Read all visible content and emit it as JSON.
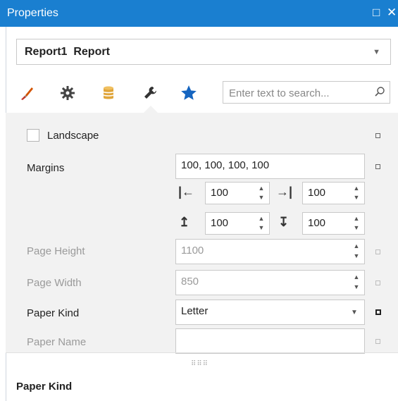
{
  "window": {
    "title": "Properties",
    "maximize_glyph": "□",
    "close_glyph": "✕"
  },
  "object_selector": {
    "name": "Report1",
    "type": "Report"
  },
  "tabs": [
    {
      "name": "appearance",
      "icon": "brush-icon"
    },
    {
      "name": "behavior",
      "icon": "gear-icon"
    },
    {
      "name": "data",
      "icon": "database-icon"
    },
    {
      "name": "layout",
      "icon": "wrench-icon",
      "selected": true
    },
    {
      "name": "favorites",
      "icon": "star-icon"
    }
  ],
  "search": {
    "placeholder": "Enter text to search..."
  },
  "properties": {
    "landscape": {
      "label": "Landscape",
      "checked": false
    },
    "margins": {
      "label": "Margins",
      "value": "100, 100, 100, 100",
      "left": "100",
      "right": "100",
      "top": "100",
      "bottom": "100"
    },
    "page_height": {
      "label": "Page Height",
      "value": "1100"
    },
    "page_width": {
      "label": "Page Width",
      "value": "850"
    },
    "paper_kind": {
      "label": "Paper Kind",
      "value": "Letter"
    },
    "paper_name": {
      "label": "Paper Name",
      "value": ""
    }
  },
  "description": {
    "title": "Paper Kind"
  },
  "colors": {
    "titlebar": "#1a7fd0",
    "star": "#1565c0",
    "database": "#e0a53a",
    "brush_tip": "#c0392b",
    "grid_bg": "#f2f2f2"
  }
}
